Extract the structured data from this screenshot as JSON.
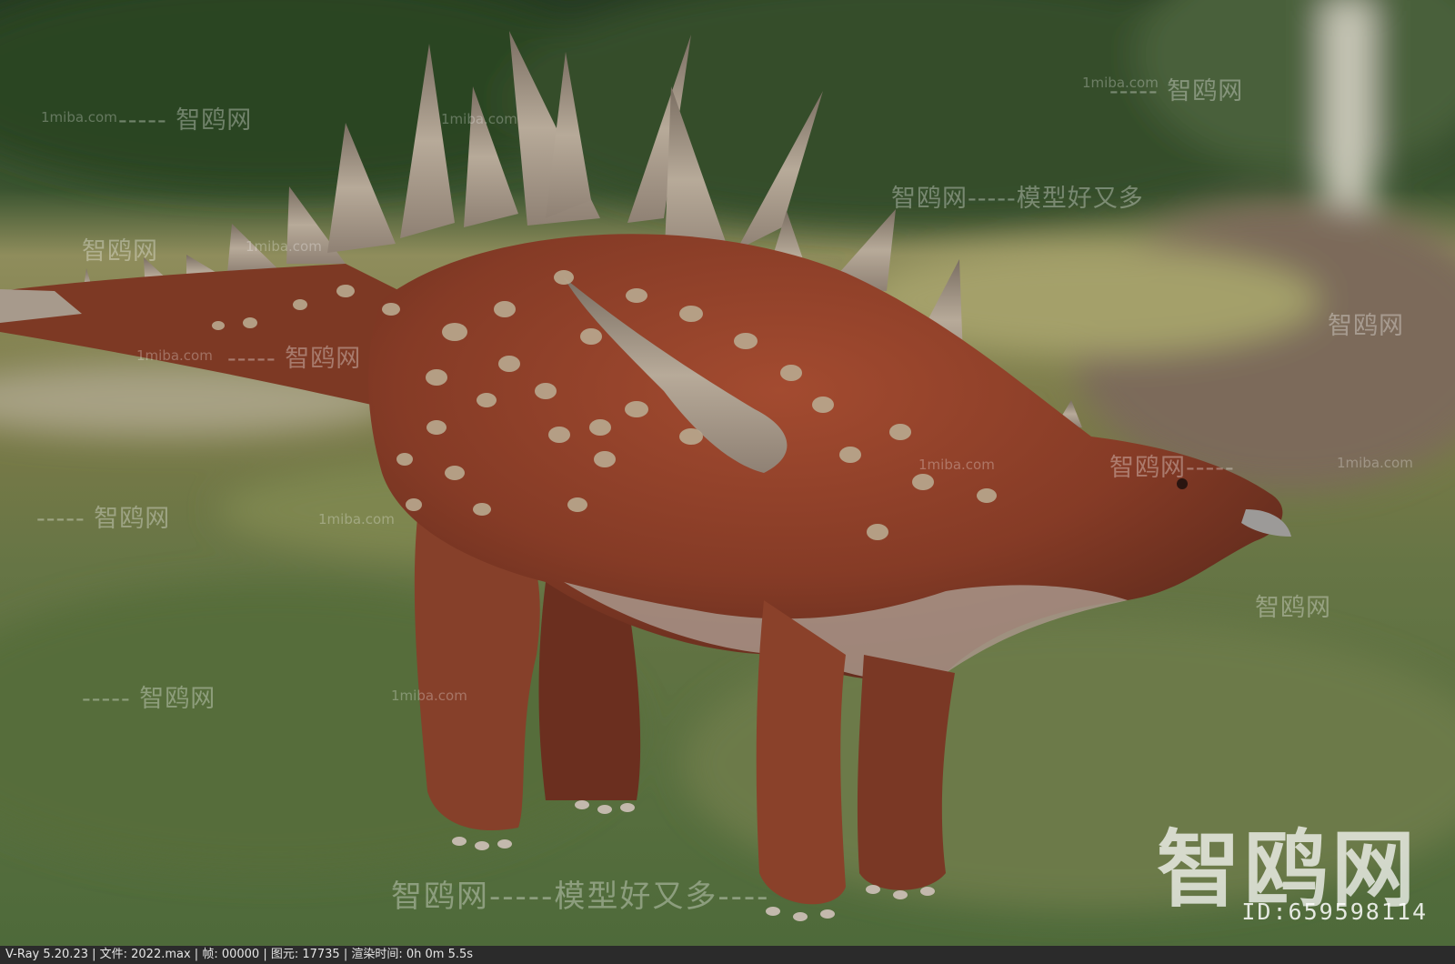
{
  "watermarks": {
    "site": "1miba.com",
    "brand_line": "智鸥网-----模型好又多",
    "brand_short": "智鸥网",
    "dash_brand": "----- 智鸥网",
    "brand_dash": "智鸥网-----",
    "big_brand": "智鸥网",
    "id_label": "ID:659598114",
    "bottom_line": "智鸥网-----模型好又多----"
  },
  "statusbar": {
    "text": "V-Ray 5.20.23 | 文件: 2022.max | 帧: 00000 | 图元: 17735 | 渲染时间: 0h  0m  5.5s"
  },
  "colors": {
    "skin": "#8a3f28",
    "spike": "#b8aa9a",
    "belly": "#a89a90",
    "forest": "#2f4a28",
    "meadow": "#8a8a4a"
  }
}
